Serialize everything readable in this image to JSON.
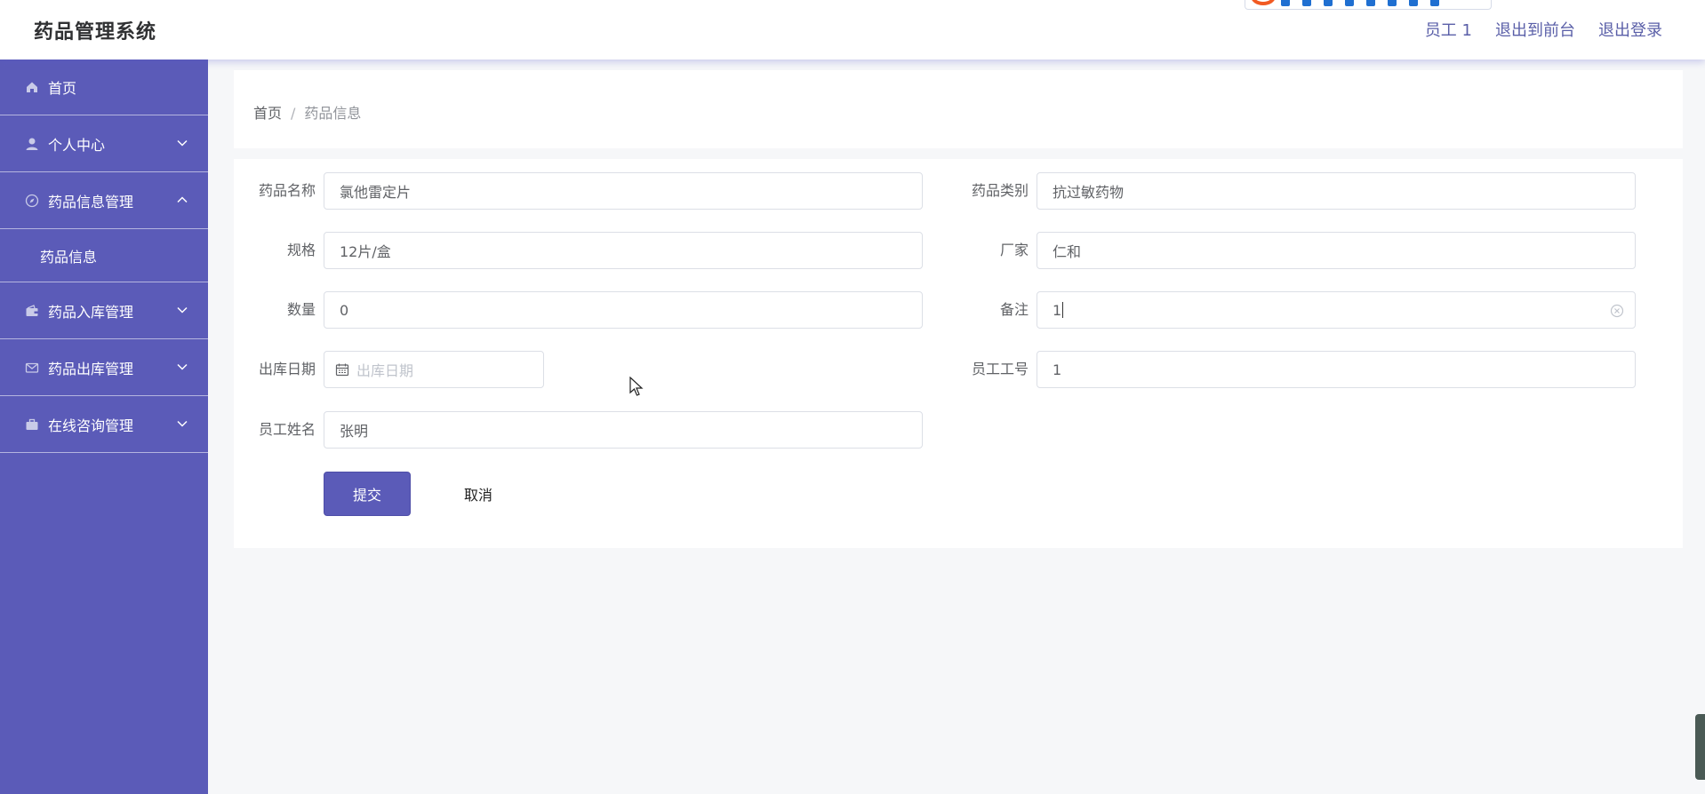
{
  "header": {
    "app_title": "药品管理系统",
    "user_label": "员工 1",
    "back_to_front": "退出到前台",
    "logout": "退出登录"
  },
  "sidebar": {
    "items": [
      {
        "label": "首页",
        "icon": "home-icon"
      },
      {
        "label": "个人中心",
        "icon": "user-icon",
        "chevron": "down"
      },
      {
        "label": "药品信息管理",
        "icon": "compass-icon",
        "chevron": "up",
        "children": [
          {
            "label": "药品信息"
          }
        ]
      },
      {
        "label": "药品入库管理",
        "icon": "wallet-icon",
        "chevron": "down"
      },
      {
        "label": "药品出库管理",
        "icon": "mail-icon",
        "chevron": "down"
      },
      {
        "label": "在线咨询管理",
        "icon": "briefcase-icon",
        "chevron": "down"
      }
    ]
  },
  "breadcrumb": {
    "home": "首页",
    "separator": "/",
    "current": "药品信息"
  },
  "form": {
    "drug_name": {
      "label": "药品名称",
      "value": "氯他雷定片"
    },
    "drug_category": {
      "label": "药品类别",
      "value": "抗过敏药物"
    },
    "spec": {
      "label": "规格",
      "value": "12片/盒"
    },
    "manufacturer": {
      "label": "厂家",
      "value": "仁和"
    },
    "quantity": {
      "label": "数量",
      "value": "0"
    },
    "remark": {
      "label": "备注",
      "value": "1"
    },
    "outbound_date": {
      "label": "出库日期",
      "placeholder": "出库日期"
    },
    "employee_no": {
      "label": "员工工号",
      "value": "1"
    },
    "employee_name": {
      "label": "员工姓名",
      "value": "张明"
    },
    "submit": "提交",
    "cancel": "取消"
  },
  "colors": {
    "sidebar_bg": "#5b5bb8",
    "primary": "#5b5bb8",
    "page_bg": "#f6f7f9"
  }
}
